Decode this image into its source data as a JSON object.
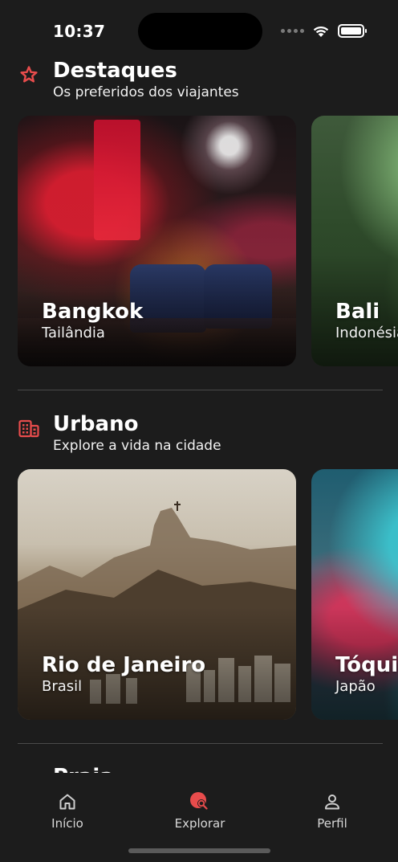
{
  "status_bar": {
    "time": "10:37"
  },
  "accent_color": "#e74c4c",
  "sections": [
    {
      "title": "Destaques",
      "subtitle": "Os preferidos dos viajantes",
      "icon": "star-icon",
      "cards": [
        {
          "name": "Bangkok",
          "country": "Tailândia"
        },
        {
          "name": "Bali",
          "country": "Indonésia"
        }
      ]
    },
    {
      "title": "Urbano",
      "subtitle": "Explore a vida na cidade",
      "icon": "buildings-icon",
      "cards": [
        {
          "name": "Rio de Janeiro",
          "country": "Brasil"
        },
        {
          "name": "Tóquio",
          "country": "Japão"
        }
      ]
    },
    {
      "title": "Praia",
      "icon": "beach-icon"
    }
  ],
  "tab_bar": {
    "items": [
      {
        "label": "Início",
        "icon": "home-icon"
      },
      {
        "label": "Explorar",
        "icon": "explore-icon",
        "active": true
      },
      {
        "label": "Perfil",
        "icon": "profile-icon"
      }
    ]
  }
}
